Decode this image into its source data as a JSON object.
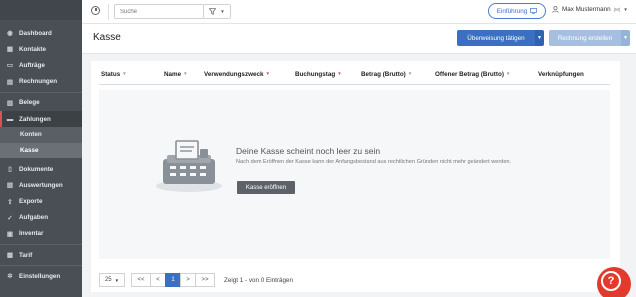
{
  "sidebar": {
    "items": [
      {
        "label": "Dashboard",
        "icon": "dashboard-icon",
        "glyph": "◉"
      },
      {
        "label": "Kontakte",
        "icon": "contacts-icon",
        "glyph": "▦"
      },
      {
        "label": "Aufträge",
        "icon": "orders-icon",
        "glyph": "▭"
      },
      {
        "label": "Rechnungen",
        "icon": "invoices-icon",
        "glyph": "▤"
      },
      {
        "label": "Belege",
        "icon": "receipts-icon",
        "glyph": "▥"
      },
      {
        "label": "Zahlungen",
        "icon": "payments-icon",
        "glyph": "▬"
      },
      {
        "label": "Dokumente",
        "icon": "documents-icon",
        "glyph": "▯"
      },
      {
        "label": "Auswertungen",
        "icon": "reports-icon",
        "glyph": "▧"
      },
      {
        "label": "Exporte",
        "icon": "export-icon",
        "glyph": "⇪"
      },
      {
        "label": "Aufgaben",
        "icon": "tasks-icon",
        "glyph": "✓"
      },
      {
        "label": "Inventar",
        "icon": "inventory-icon",
        "glyph": "▣"
      },
      {
        "label": "Tarif",
        "icon": "tariff-icon",
        "glyph": "▩"
      },
      {
        "label": "Einstellungen",
        "icon": "settings-icon",
        "glyph": "✲"
      }
    ],
    "sub_items": [
      {
        "label": "Konten"
      },
      {
        "label": "Kasse"
      }
    ]
  },
  "topbar": {
    "search_placeholder": "Suche",
    "intro_label": "Einführung",
    "user_name": "Max Mustermann",
    "user_suffix": "(M)"
  },
  "header": {
    "title": "Kasse",
    "primary_button": "Überweisung tätigen",
    "secondary_button": "Rechnung erstellen"
  },
  "table": {
    "columns": [
      {
        "label": "Status",
        "sort": "grey"
      },
      {
        "label": "Name",
        "sort": "grey"
      },
      {
        "label": "Verwendungszweck",
        "sort": "red"
      },
      {
        "label": "Buchungstag",
        "sort": "red"
      },
      {
        "label": "Betrag (Brutto)",
        "sort": "grey"
      },
      {
        "label": "Offener Betrag (Brutto)",
        "sort": "grey"
      },
      {
        "label": "Verknüpfungen",
        "sort": ""
      }
    ]
  },
  "empty_state": {
    "title": "Deine Kasse scheint noch leer zu sein",
    "subtitle": "Nach dem Eröffnen der Kasse kann der Anfangsbestand aus rechtlichen Gründen nicht mehr geändert werden.",
    "button": "Kasse eröffnen"
  },
  "pagination": {
    "page_size": "25",
    "first": "<<",
    "prev": "<",
    "current": "1",
    "next": ">",
    "last": ">>",
    "info": "Zeigt 1 - von 0 Einträgen"
  },
  "colors": {
    "primary": "#3a6fc2",
    "accent_red": "#d9534f",
    "help": "#e23b2e"
  }
}
